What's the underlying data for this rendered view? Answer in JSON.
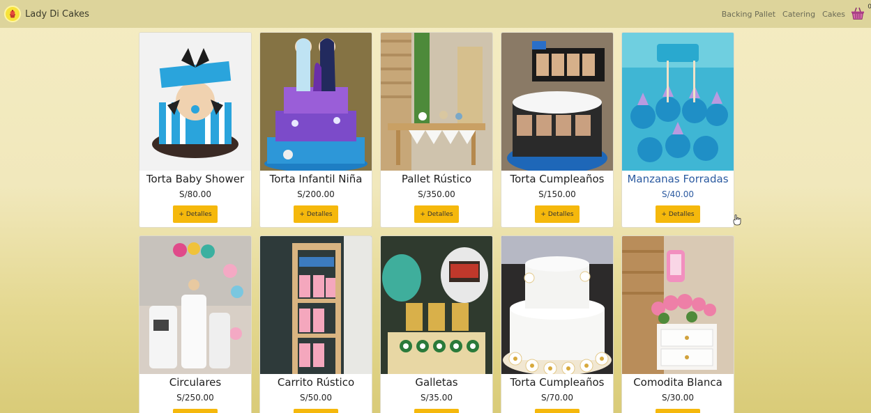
{
  "navbar": {
    "brand": "Lady Di Cakes",
    "logo_icon": "cupcake-logo-icon",
    "links": [
      "Backing Pallet",
      "Catering",
      "Cakes"
    ],
    "cart_icon": "basket-icon",
    "cart_count": "0"
  },
  "button_label": "+ Detalles",
  "products": [
    {
      "title": "Torta Baby Shower",
      "price": "S/80.00",
      "image": "baby-shower-cake-photo"
    },
    {
      "title": "Torta Infantil Niña",
      "price": "S/200.00",
      "image": "frozen-cake-photo"
    },
    {
      "title": "Pallet Rústico",
      "price": "S/350.00",
      "image": "rustic-pallet-table-photo"
    },
    {
      "title": "Torta Cumpleaños",
      "price": "S/150.00",
      "image": "photo-reel-birthday-cake-photo"
    },
    {
      "title": "Manzanas Forradas",
      "price": "S/40.00",
      "image": "mermaid-covered-apples-photo"
    },
    {
      "title": "Circulares",
      "price": "S/250.00",
      "image": "circular-pedestals-photo"
    },
    {
      "title": "Carrito Rústico",
      "price": "S/50.00",
      "image": "rustic-cart-photo"
    },
    {
      "title": "Galletas",
      "price": "S/35.00",
      "image": "soccer-cookies-photo"
    },
    {
      "title": "Torta Cumpleaños",
      "price": "S/70.00",
      "image": "white-flower-cake-photo"
    },
    {
      "title": "Comodita Blanca",
      "price": "S/30.00",
      "image": "white-dresser-photo"
    }
  ],
  "colors": {
    "navbar": "#ddd49b",
    "background": "#f4ecc2",
    "button": "#f5b80c",
    "hover_text": "#2b5aa0"
  }
}
